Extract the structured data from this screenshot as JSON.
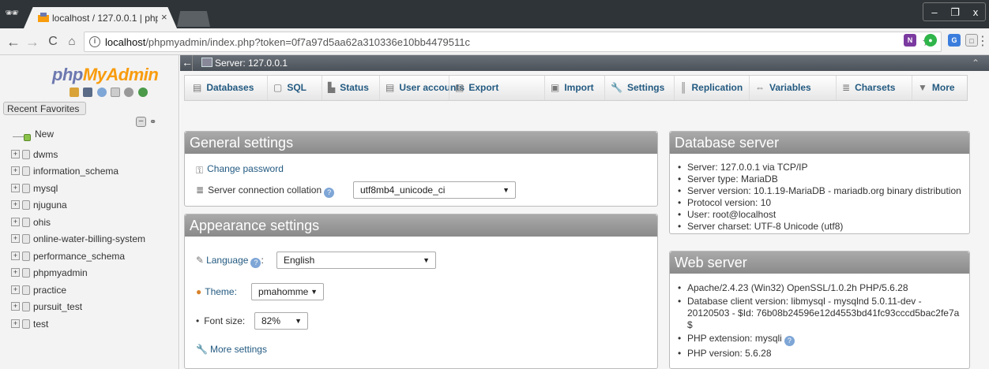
{
  "browser": {
    "tab_title": "localhost / 127.0.0.1 | php",
    "tab_close": "×",
    "url_host": "localhost",
    "url_path": "/phpmyadmin/index.php?token=0f7a97d5aa62a310336e10bb4479511c",
    "window_controls": [
      "–",
      "❐",
      "x"
    ]
  },
  "nav": {
    "logo_php": "php",
    "logo_myadmin": "MyAdmin",
    "recent": "Recent",
    "favorites": "Favorites",
    "new_label": "New",
    "databases": [
      "dwms",
      "information_schema",
      "mysql",
      "njuguna",
      "ohis",
      "online-water-billing-system",
      "performance_schema",
      "phpmyadmin",
      "practice",
      "pursuit_test",
      "test"
    ]
  },
  "server_bar": {
    "label": "Server: 127.0.0.1"
  },
  "tabs": [
    {
      "label": "Databases",
      "icon": "databases-icon",
      "glyph": "▤"
    },
    {
      "label": "SQL",
      "icon": "sql-icon",
      "glyph": "▢"
    },
    {
      "label": "Status",
      "icon": "status-icon",
      "glyph": "▙"
    },
    {
      "label": "User accounts",
      "icon": "users-icon",
      "glyph": "▤"
    },
    {
      "label": "Export",
      "icon": "export-icon",
      "glyph": "▤"
    },
    {
      "label": "Import",
      "icon": "import-icon",
      "glyph": "▣"
    },
    {
      "label": "Settings",
      "icon": "wrench-icon",
      "glyph": "🔧"
    },
    {
      "label": "Replication",
      "icon": "replication-icon",
      "glyph": "║"
    },
    {
      "label": "Variables",
      "icon": "variables-icon",
      "glyph": "⇔"
    },
    {
      "label": "Charsets",
      "icon": "charsets-icon",
      "glyph": "≣"
    },
    {
      "label": "More",
      "icon": "more-icon",
      "glyph": "▼"
    }
  ],
  "general": {
    "title": "General settings",
    "change_password": "Change password",
    "collation_label": "Server connection collation",
    "collation_value": "utf8mb4_unicode_ci"
  },
  "appearance": {
    "title": "Appearance settings",
    "language_label": "Language",
    "language_value": "English",
    "theme_label": "Theme:",
    "theme_value": "pmahomme",
    "fontsize_label": "Font size:",
    "fontsize_value": "82%",
    "more_settings": "More settings"
  },
  "db_server": {
    "title": "Database server",
    "items": [
      "Server: 127.0.0.1 via TCP/IP",
      "Server type: MariaDB",
      "Server version: 10.1.19-MariaDB - mariadb.org binary distribution",
      "Protocol version: 10",
      "User: root@localhost",
      "Server charset: UTF-8 Unicode (utf8)"
    ]
  },
  "web_server": {
    "title": "Web server",
    "items": [
      "Apache/2.4.23 (Win32) OpenSSL/1.0.2h PHP/5.6.28",
      "Database client version: libmysql - mysqlnd 5.0.11-dev - 20120503 - $Id: 76b08b24596e12d4553bd41fc93cccd5bac2fe7a $",
      "PHP extension: mysqli",
      "PHP version: 5.6.28"
    ]
  },
  "colors": {
    "link": "#235a81",
    "logo_php": "#6c78af",
    "logo_myadmin": "#f89c0e",
    "panel_head": "#9a9a9a"
  }
}
